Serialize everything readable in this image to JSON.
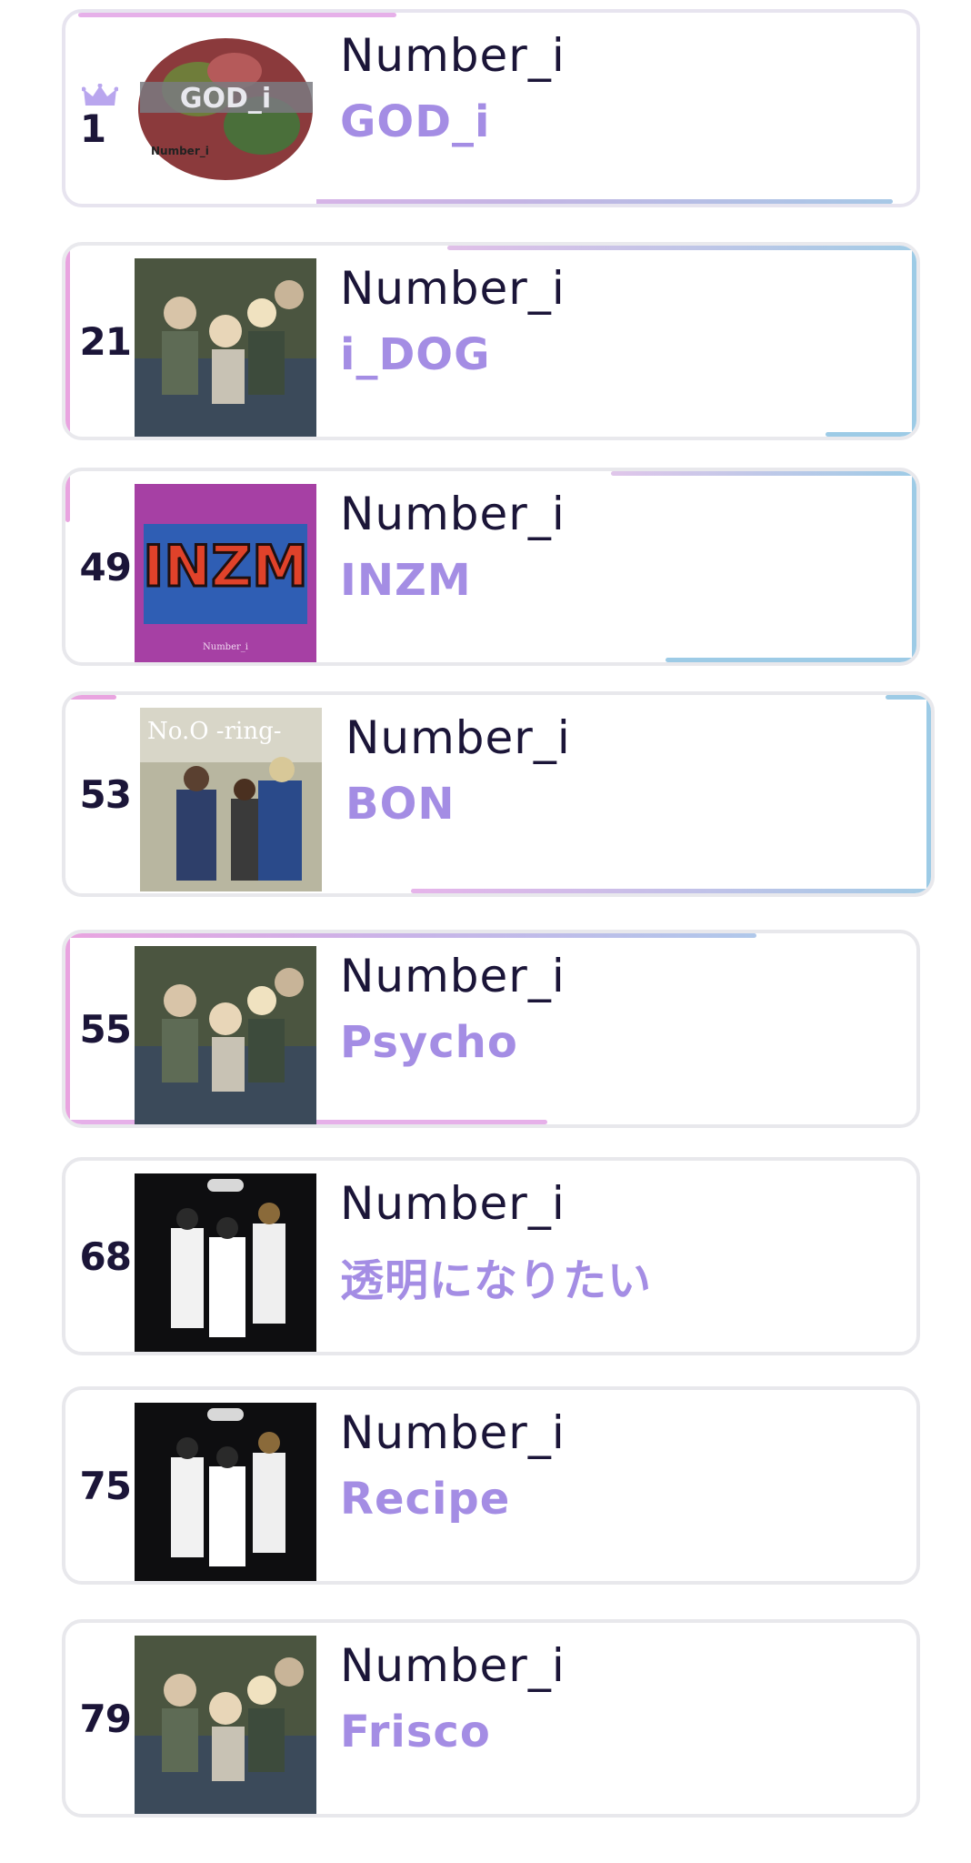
{
  "items": [
    {
      "rank": "1",
      "artist": "Number_i",
      "title": "GOD_i",
      "crown_icon": "crown-icon",
      "cover_text": "GOD_i",
      "cover_sub": "Number_i"
    },
    {
      "rank": "21",
      "artist": "Number_i",
      "title": "i_DOG"
    },
    {
      "rank": "49",
      "artist": "Number_i",
      "title": "INZM",
      "cover_text": "INZM",
      "cover_sub": "Number_i"
    },
    {
      "rank": "53",
      "artist": "Number_i",
      "title": "BON",
      "cover_text": "No.O -ring-"
    },
    {
      "rank": "55",
      "artist": "Number_i",
      "title": "Psycho"
    },
    {
      "rank": "68",
      "artist": "Number_i",
      "title": "透明になりたい"
    },
    {
      "rank": "75",
      "artist": "Number_i",
      "title": "Recipe"
    },
    {
      "rank": "79",
      "artist": "Number_i",
      "title": "Frisco"
    }
  ],
  "colors": {
    "rank_text": "#1b1538",
    "artist_text": "#1b1538",
    "title_text": "#a48de4",
    "pink": "#e7a6e3",
    "blue": "#8ec3e2"
  }
}
